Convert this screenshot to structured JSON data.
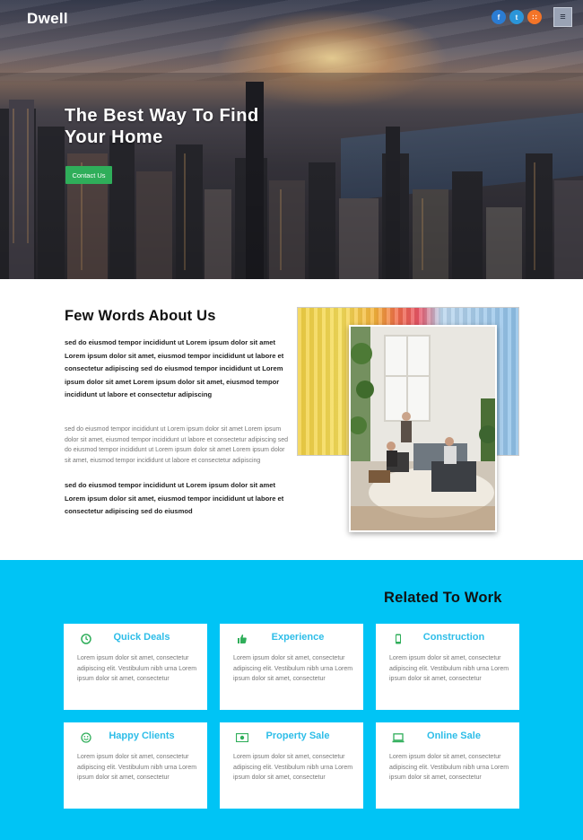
{
  "header": {
    "brand": "Dwell",
    "socials": [
      {
        "icon": "facebook-icon",
        "glyph": "f"
      },
      {
        "icon": "twitter-icon",
        "glyph": "t"
      },
      {
        "icon": "rss-icon",
        "glyph": "∷"
      }
    ],
    "menu_glyph": "≡"
  },
  "hero": {
    "title_line1": "The Best Way To Find",
    "title_line2": "Your Home",
    "cta_label": "Contact Us"
  },
  "about": {
    "title": "Few Words About Us",
    "paragraph1": "sed do eiusmod tempor incididunt ut Lorem ipsum dolor sit amet Lorem ipsum dolor sit amet, eiusmod tempor incididunt ut labore et consectetur adipiscing sed do eiusmod tempor incididunt ut Lorem ipsum dolor sit amet Lorem ipsum dolor sit amet, eiusmod tempor incididunt ut labore et consectetur adipiscing",
    "paragraph2": "sed do eiusmod tempor incididunt ut Lorem ipsum dolor sit amet Lorem ipsum dolor sit amet, eiusmod tempor incididunt ut labore et consectetur adipiscing sed do eiusmod tempor incididunt ut Lorem ipsum dolor sit amet Lorem ipsum dolor sit amet, eiusmod tempor incididunt ut labore et consectetur adipiscing",
    "paragraph3": "sed do eiusmod tempor incididunt ut Lorem ipsum dolor sit amet Lorem ipsum dolor sit amet, eiusmod tempor incididunt ut labore et consectetur adipiscing sed do eiusmod"
  },
  "services": {
    "title": "Related To Work",
    "cards": [
      {
        "title": "Quick Deals",
        "icon": "clock-icon",
        "text": "Lorem ipsum dolor sit amet, consectetur adipiscing elit. Vestibulum nibh urna Lorem ipsum dolor sit amet, consectetur"
      },
      {
        "title": "Experience",
        "icon": "thumbs-up-icon",
        "text": "Lorem ipsum dolor sit amet, consectetur adipiscing elit. Vestibulum nibh urna Lorem ipsum dolor sit amet, consectetur"
      },
      {
        "title": "Construction",
        "icon": "mobile-icon",
        "text": "Lorem ipsum dolor sit amet, consectetur adipiscing elit. Vestibulum nibh urna Lorem ipsum dolor sit amet, consectetur"
      },
      {
        "title": "Happy Clients",
        "icon": "smile-icon",
        "text": "Lorem ipsum dolor sit amet, consectetur adipiscing elit. Vestibulum nibh urna Lorem ipsum dolor sit amet, consectetur"
      },
      {
        "title": "Property Sale",
        "icon": "money-icon",
        "text": "Lorem ipsum dolor sit amet, consectetur adipiscing elit. Vestibulum nibh urna Lorem ipsum dolor sit amet, consectetur"
      },
      {
        "title": "Online Sale",
        "icon": "laptop-icon",
        "text": "Lorem ipsum dolor sit amet, consectetur adipiscing elit. Vestibulum nibh urna Lorem ipsum dolor sit amet, consectetur"
      }
    ]
  },
  "colors": {
    "accent_blue": "#00c4f5",
    "card_title": "#2dbde8",
    "cta_green": "#2fae5a",
    "icon_green": "#2fae5a"
  }
}
